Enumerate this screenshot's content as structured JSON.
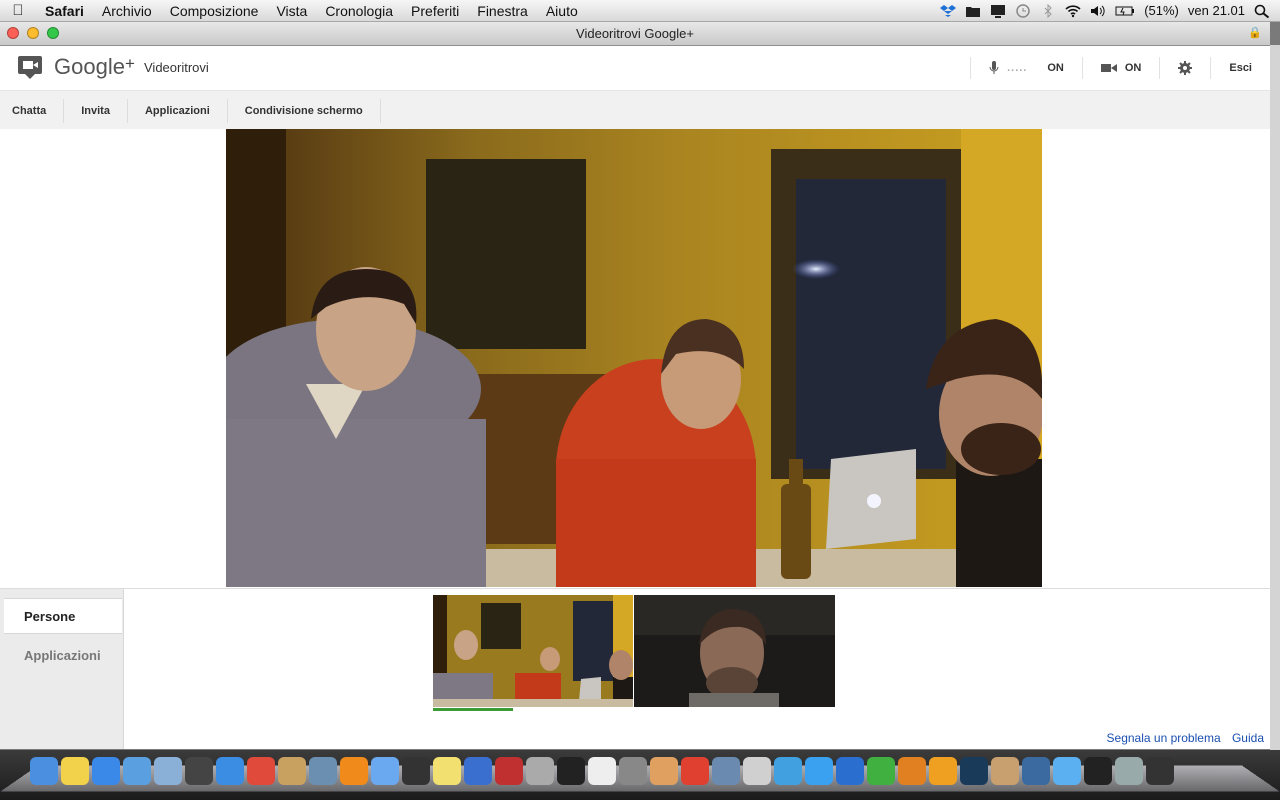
{
  "menubar": {
    "items": [
      "Safari",
      "Archivio",
      "Composizione",
      "Vista",
      "Cronologia",
      "Preferiti",
      "Finestra",
      "Aiuto"
    ],
    "battery": "(51%)",
    "clock": "ven 21.01"
  },
  "window": {
    "title": "Videoritrovi Google+"
  },
  "header": {
    "logo": "Google",
    "logo_plus": "+",
    "app_name": "Videoritrovi",
    "mic_meter": ".....",
    "mic_state": "ON",
    "cam_state": "ON",
    "exit_label": "Esci"
  },
  "tabs": [
    "Chatta",
    "Invita",
    "Applicazioni",
    "Condivisione schermo"
  ],
  "sidebar_tabs": [
    "Persone",
    "Applicazioni"
  ],
  "footer_links": {
    "report": "Segnala un problema",
    "help": "Guida"
  },
  "colors": {
    "speaking_indicator": "#3d9b35",
    "link": "#1a4fb0"
  },
  "dock_icons": [
    "finder",
    "stickies",
    "app-store",
    "mail",
    "preview",
    "dashboard",
    "safari",
    "ical",
    "contacts",
    "iphoto",
    "vlc",
    "itunes",
    "music",
    "notes",
    "photo-booth",
    "settings",
    "calendar",
    "home",
    "voice",
    "pages",
    "image-capture",
    "pen",
    "keynote",
    "bamboo",
    "pinwheel",
    "kindle",
    "book",
    "network",
    "icloud",
    "film",
    "sketch",
    "kindle-2",
    "gear",
    "folder-apps",
    "folder-docs",
    "folder-downloads",
    "trash"
  ]
}
